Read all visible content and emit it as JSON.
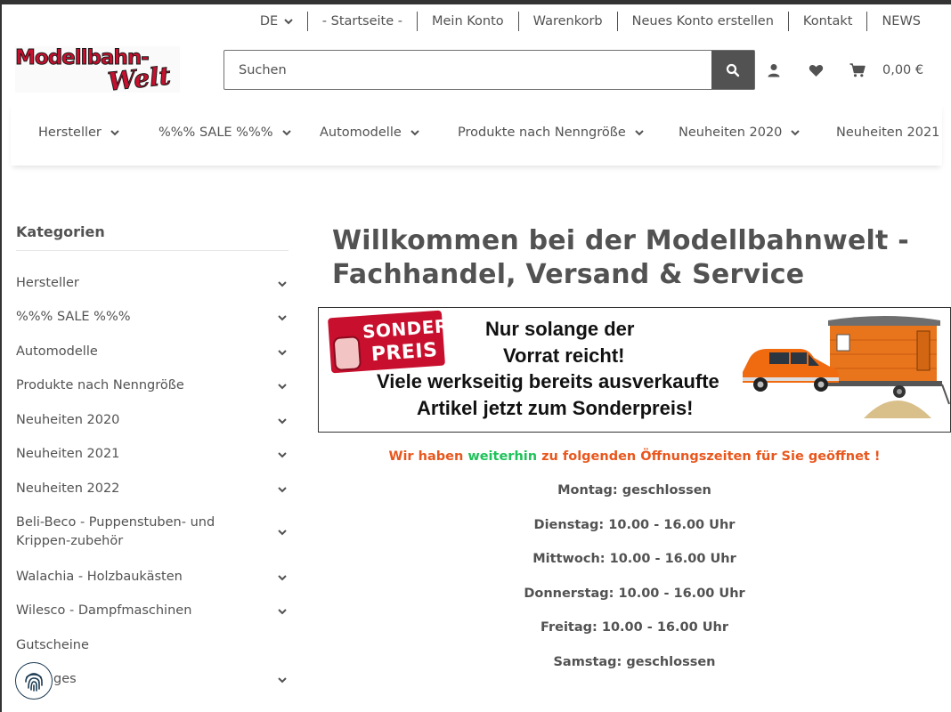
{
  "topbar": {
    "language": "DE",
    "links": [
      "- Startseite -",
      "Mein Konto",
      "Warenkorb",
      "Neues Konto erstellen",
      "Kontakt",
      "NEWS"
    ]
  },
  "logo": {
    "line1": "Modellbahn-",
    "line2": "Welt"
  },
  "search": {
    "placeholder": "Suchen"
  },
  "header": {
    "cart_total": "0,00 €"
  },
  "mainnav": {
    "items": [
      "Hersteller",
      "%%% SALE %%%",
      "Automodelle",
      "Produkte nach Nenngröße",
      "Neuheiten 2020",
      "Neuheiten 2021"
    ]
  },
  "sidebar": {
    "title": "Kategorien",
    "categories": [
      "Hersteller",
      "%%% SALE %%%",
      "Automodelle",
      "Produkte nach Nenngröße",
      "Neuheiten 2020",
      "Neuheiten 2021",
      "Neuheiten 2022",
      "Beli-Beco - Puppenstuben- und Krippen-zubehör",
      "Walachia - Holzbaukästen",
      "Wilesco - Dampfmaschinen",
      "Gutscheine",
      "Sonstiges"
    ],
    "partial_last": "ges"
  },
  "content": {
    "title": "Willkommen bei der Modellbahnwelt - Fachhandel, Versand & Service",
    "banner": {
      "stamp_line1": "SONDER",
      "stamp_line2": "PREIS",
      "line1": "Nur solange der",
      "line2": "Vorrat reicht!",
      "line3": "Viele werkseitig bereits ausverkaufte",
      "line4": "Artikel jetzt zum Sonderpreis!"
    },
    "hours_intro": {
      "part1": "Wir haben ",
      "part2": "weiterhin",
      "part3": " zu folgenden Öffnungszeiten für Sie geöffnet !"
    },
    "hours": [
      "Montag: geschlossen",
      "Dienstag: 10.00 - 16.00 Uhr",
      "Mittwoch: 10.00 - 16.00 Uhr",
      "Donnerstag: 10.00 - 16.00 Uhr",
      "Freitag: 10.00 - 16.00 Uhr",
      "Samstag: geschlossen"
    ]
  },
  "colors": {
    "text": "#525252",
    "brand_red": "#c8102e",
    "orange": "#e8571d",
    "green": "#1ec25a"
  }
}
